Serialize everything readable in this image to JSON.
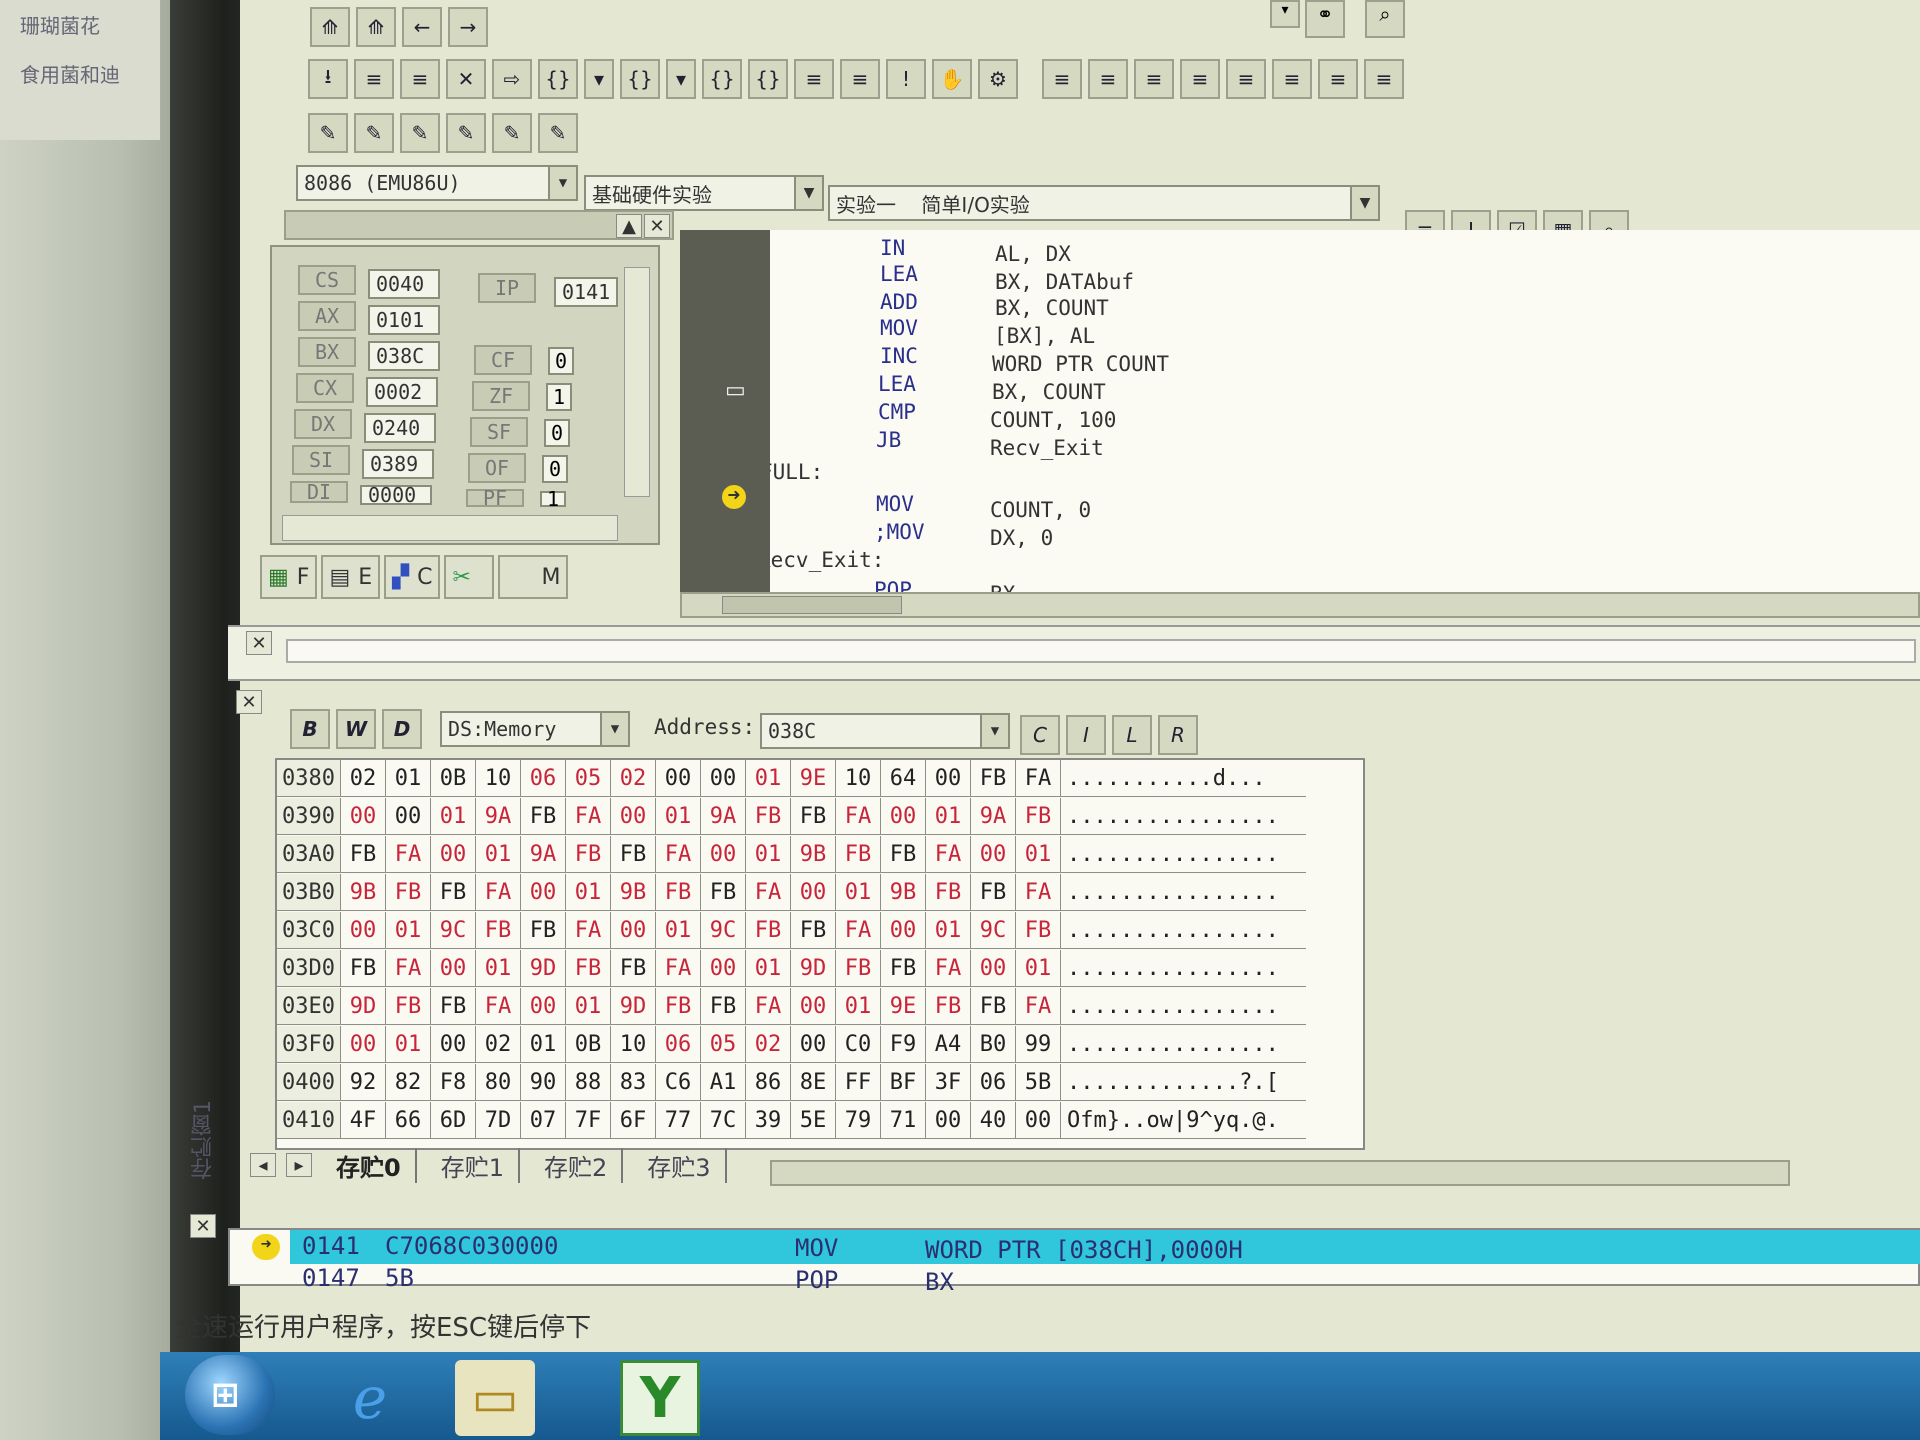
{
  "sticker": {
    "line1": "珊瑚菌花",
    "line2": "食用菌和迪"
  },
  "toolbar": {
    "row1": [
      "⟰",
      "⟰",
      "←",
      "→"
    ],
    "row2": [
      "⭳",
      "≡",
      "≡",
      "✕",
      "⇨",
      "{}",
      "▾",
      "{}",
      "▾",
      "{}",
      "{}",
      "≡",
      "≡",
      "!",
      "✋",
      "⚙",
      "≡",
      "≡",
      "≡",
      "≡",
      "≡",
      "≡",
      "≡",
      "≡"
    ],
    "row3": [
      "✎",
      "✎",
      "✎",
      "✎",
      "✎",
      "✎"
    ]
  },
  "combos": {
    "cpu": "8086 (EMU86U)",
    "category": "基础硬件实验",
    "experiment": "实验一    简单I/O实验"
  },
  "registers": [
    {
      "name": "CS",
      "value": "0040"
    },
    {
      "name": "AX",
      "value": "0101"
    },
    {
      "name": "BX",
      "value": "038C"
    },
    {
      "name": "CX",
      "value": "0002"
    },
    {
      "name": "DX",
      "value": "0240"
    },
    {
      "name": "SI",
      "value": "0389"
    },
    {
      "name": "DI",
      "value": "0000"
    }
  ],
  "ip": {
    "name": "IP",
    "value": "0141"
  },
  "flags": [
    {
      "name": "CF",
      "value": "0"
    },
    {
      "name": "ZF",
      "value": "1"
    },
    {
      "name": "SF",
      "value": "0"
    },
    {
      "name": "OF",
      "value": "0"
    },
    {
      "name": "PF",
      "value": "1"
    }
  ],
  "left_tabs": [
    "F",
    "E",
    "C",
    "",
    "M"
  ],
  "code": [
    {
      "label": "",
      "op": "IN",
      "args": "AL, DX"
    },
    {
      "label": "",
      "op": "LEA",
      "args": "BX, DATAbuf"
    },
    {
      "label": "",
      "op": "ADD",
      "args": "BX, COUNT"
    },
    {
      "label": "",
      "op": "MOV",
      "args": "[BX], AL"
    },
    {
      "label": "",
      "op": "INC",
      "args": "WORD PTR COUNT"
    },
    {
      "label": "",
      "op": "LEA",
      "args": "BX, COUNT"
    },
    {
      "label": "",
      "op": "CMP",
      "args": "COUNT, 100"
    },
    {
      "label": "",
      "op": "JB",
      "args": "Recv_Exit"
    },
    {
      "label": "FULL:",
      "op": "",
      "args": ""
    },
    {
      "label": "",
      "op": "MOV",
      "args": "COUNT, 0"
    },
    {
      "label": "",
      "op": ";MOV",
      "args": "DX, 0"
    },
    {
      "label": "Recv_Exit:",
      "op": "",
      "args": ""
    },
    {
      "label": "",
      "op": "POP",
      "args": "BX"
    }
  ],
  "memory_toolbar": {
    "byte_btn": "B",
    "word_btn": "W",
    "dword_btn": "D",
    "segment": "DS:Memory",
    "address_label": "Address:",
    "address_value": "038C",
    "btn_c": "C",
    "btn_i": "I",
    "btn_l": "L",
    "btn_r": "R"
  },
  "memory": [
    {
      "addr": "0380",
      "bytes": [
        "02",
        "01",
        "0B",
        "10",
        "06",
        "05",
        "02",
        "00",
        "00",
        "01",
        "9E",
        "10",
        "64",
        "00",
        "FB",
        "FA"
      ],
      "red": [
        4,
        5,
        6,
        9,
        10
      ],
      "ascii": "...........d..."
    },
    {
      "addr": "0390",
      "bytes": [
        "00",
        "00",
        "01",
        "9A",
        "FB",
        "FA",
        "00",
        "01",
        "9A",
        "FB",
        "FB",
        "FA",
        "00",
        "01",
        "9A",
        "FB"
      ],
      "red": [
        0,
        2,
        3,
        5,
        6,
        7,
        8,
        9,
        11,
        12,
        13,
        14,
        15
      ],
      "ascii": "................"
    },
    {
      "addr": "03A0",
      "bytes": [
        "FB",
        "FA",
        "00",
        "01",
        "9A",
        "FB",
        "FB",
        "FA",
        "00",
        "01",
        "9B",
        "FB",
        "FB",
        "FA",
        "00",
        "01"
      ],
      "red": [
        1,
        2,
        3,
        4,
        5,
        7,
        8,
        9,
        10,
        11,
        13,
        14,
        15
      ],
      "ascii": "................"
    },
    {
      "addr": "03B0",
      "bytes": [
        "9B",
        "FB",
        "FB",
        "FA",
        "00",
        "01",
        "9B",
        "FB",
        "FB",
        "FA",
        "00",
        "01",
        "9B",
        "FB",
        "FB",
        "FA"
      ],
      "red": [
        0,
        1,
        3,
        4,
        5,
        6,
        7,
        9,
        10,
        11,
        12,
        13,
        15
      ],
      "ascii": "................"
    },
    {
      "addr": "03C0",
      "bytes": [
        "00",
        "01",
        "9C",
        "FB",
        "FB",
        "FA",
        "00",
        "01",
        "9C",
        "FB",
        "FB",
        "FA",
        "00",
        "01",
        "9C",
        "FB"
      ],
      "red": [
        0,
        1,
        2,
        3,
        5,
        6,
        7,
        8,
        9,
        11,
        12,
        13,
        14,
        15
      ],
      "ascii": "................"
    },
    {
      "addr": "03D0",
      "bytes": [
        "FB",
        "FA",
        "00",
        "01",
        "9D",
        "FB",
        "FB",
        "FA",
        "00",
        "01",
        "9D",
        "FB",
        "FB",
        "FA",
        "00",
        "01"
      ],
      "red": [
        1,
        2,
        3,
        4,
        5,
        7,
        8,
        9,
        10,
        11,
        13,
        14,
        15
      ],
      "ascii": "................"
    },
    {
      "addr": "03E0",
      "bytes": [
        "9D",
        "FB",
        "FB",
        "FA",
        "00",
        "01",
        "9D",
        "FB",
        "FB",
        "FA",
        "00",
        "01",
        "9E",
        "FB",
        "FB",
        "FA"
      ],
      "red": [
        0,
        1,
        3,
        4,
        5,
        6,
        7,
        9,
        10,
        11,
        12,
        13,
        15
      ],
      "ascii": "................"
    },
    {
      "addr": "03F0",
      "bytes": [
        "00",
        "01",
        "00",
        "02",
        "01",
        "0B",
        "10",
        "06",
        "05",
        "02",
        "00",
        "C0",
        "F9",
        "A4",
        "B0",
        "99"
      ],
      "red": [
        0,
        1,
        7,
        8,
        9
      ],
      "ascii": "................"
    },
    {
      "addr": "0400",
      "bytes": [
        "92",
        "82",
        "F8",
        "80",
        "90",
        "88",
        "83",
        "C6",
        "A1",
        "86",
        "8E",
        "FF",
        "BF",
        "3F",
        "06",
        "5B"
      ],
      "red": [],
      "ascii": ".............?.["
    },
    {
      "addr": "0410",
      "bytes": [
        "4F",
        "66",
        "6D",
        "7D",
        "07",
        "7F",
        "6F",
        "77",
        "7C",
        "39",
        "5E",
        "79",
        "71",
        "00",
        "40",
        "00"
      ],
      "red": [],
      "ascii": "Ofm}..ow|9^yq.@."
    }
  ],
  "memory_tabs": [
    "存贮0",
    "存贮1",
    "存贮2",
    "存贮3"
  ],
  "memory_side_caption": "存贮窗1",
  "disasm": [
    {
      "addr": "0141",
      "code": "C7068C030000",
      "op": "MOV",
      "args": "WORD PTR [038CH],0000H"
    },
    {
      "addr": "0147",
      "code": "5B",
      "op": "POP",
      "args": "BX"
    }
  ],
  "status": "全速运行用户程序，按ESC键后停下",
  "colors": {
    "highlight": "#30c6dc",
    "changed_byte": "#c8243a",
    "taskbar": "#1f6aa5"
  },
  "taskbar_icons": [
    "windows-start",
    "internet-explorer",
    "file-explorer",
    "app-icon"
  ]
}
